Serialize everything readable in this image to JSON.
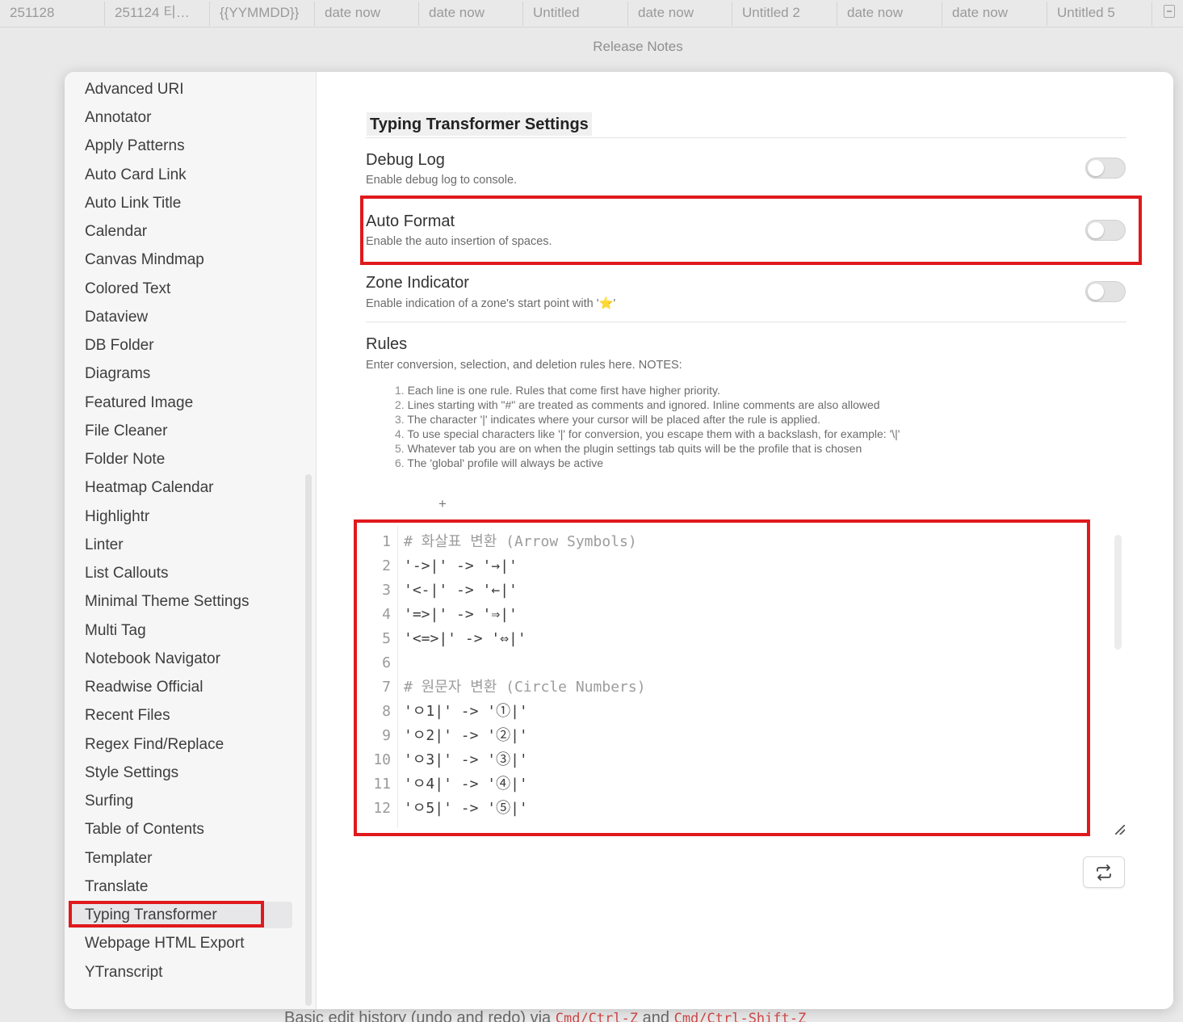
{
  "tabs": [
    "251128",
    "251124 티스…",
    "{{YYMMDD}}",
    "date now",
    "date now",
    "Untitled",
    "date now",
    "Untitled 2",
    "date now",
    "date now",
    "Untitled 5"
  ],
  "page_header": "Release Notes",
  "background_line": {
    "text_start": "Basic edit history (undo and redo) via ",
    "code_1": "Cmd/Ctrl-Z",
    "text_mid": " and ",
    "code_2": "Cmd/Ctrl-Shift-Z"
  },
  "sidebar": {
    "items": [
      "Advanced URI",
      "Annotator",
      "Apply Patterns",
      "Auto Card Link",
      "Auto Link Title",
      "Calendar",
      "Canvas Mindmap",
      "Colored Text",
      "Dataview",
      "DB Folder",
      "Diagrams",
      "Featured Image",
      "File Cleaner",
      "Folder Note",
      "Heatmap Calendar",
      "Highlightr",
      "Linter",
      "List Callouts",
      "Minimal Theme Settings",
      "Multi Tag",
      "Notebook Navigator",
      "Readwise Official",
      "Recent Files",
      "Regex Find/Replace",
      "Style Settings",
      "Surfing",
      "Table of Contents",
      "Templater",
      "Translate",
      "Typing Transformer",
      "Webpage HTML Export",
      "YTranscript"
    ],
    "active": "Typing Transformer"
  },
  "settings": {
    "title": "Typing Transformer Settings",
    "debug_log": {
      "name": "Debug Log",
      "desc": "Enable debug log to console.",
      "enabled": false
    },
    "auto_format": {
      "name": "Auto Format",
      "desc": "Enable the auto insertion of spaces.",
      "enabled": false
    },
    "zone_indicator": {
      "name": "Zone Indicator",
      "desc_start": "Enable indication of a zone's start point with '",
      "star": "⭐",
      "desc_end": "'",
      "enabled": false
    },
    "rules": {
      "name": "Rules",
      "desc": "Enter conversion, selection, and deletion rules here. NOTES:",
      "notes": [
        "Each line is one rule. Rules that come first have higher priority.",
        "Lines starting with \"#\" are treated as comments and ignored. Inline comments are also allowed",
        "The character '|' indicates where your cursor will be placed after the rule is applied.",
        "To use special characters like '|' for conversion, you escape them with a backslash, for example: '\\|'",
        "Whatever tab you are on when the plugin settings tab quits will be the profile that is chosen",
        "The 'global' profile will always be active"
      ]
    },
    "add_profile": "+",
    "code_lines": [
      "# 화살표 변환 (Arrow Symbols)",
      "'->|' -> '→|'",
      "'<-|' -> '←|'",
      "'=>|' -> '⇒|'",
      "'<=>|' -> '⇔|'",
      "",
      "# 원문자 변환 (Circle Numbers)",
      "'ㅇ1|' -> '①|'",
      "'ㅇ2|' -> '②|'",
      "'ㅇ3|' -> '③|'",
      "'ㅇ4|' -> '④|'",
      "'ㅇ5|' -> '⑤|'"
    ]
  },
  "icons": {
    "new_tab": "new-tab-icon",
    "swap": "swap-arrows-icon",
    "resize": "resize-handle-icon"
  },
  "colors": {
    "highlight": "#e0191c",
    "star": "#f3b400"
  }
}
